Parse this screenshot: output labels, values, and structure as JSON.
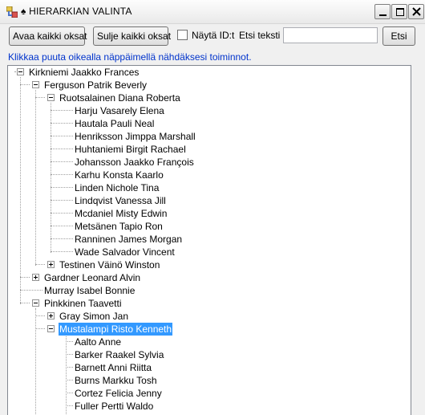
{
  "window": {
    "title": "HIERARKIAN VALINTA",
    "title_icon": "spade-icon"
  },
  "toolbar": {
    "expand_all_label": "Avaa kaikki oksat",
    "collapse_all_label": "Sulje kaikki oksat",
    "show_id_label": "Näytä ID:t",
    "show_id_checked": false,
    "search_label": "Etsi teksti",
    "search_value": "",
    "search_button_label": "Etsi"
  },
  "hint": "Klikkaa puuta oikealla näppäimellä nähdäksesi toiminnot.",
  "tree": {
    "root": "Kirkniemi Jaakko Frances",
    "nodes": [
      "Ferguson Patrik Beverly",
      "Ruotsalainen Diana Roberta",
      "Harju Vasarely Elena",
      "Hautala Pauli Neal",
      "Henriksson Jimppa Marshall",
      "Huhtaniemi Birgit Rachael",
      "Johansson Jaakko François",
      "Karhu Konsta Kaarlo",
      "Linden Nichole Tina",
      "Lindqvist Vanessa Jill",
      "Mcdaniel Misty Edwin",
      "Metsänen Tapio Ron",
      "Ranninen James Morgan",
      "Wade Salvador Vincent",
      "Testinen Väinö Winston",
      "Gardner Leonard Alvin",
      "Murray Isabel Bonnie",
      "Pinkkinen Taavetti",
      "Gray Simon Jan",
      "Mustalampi Risto Kenneth",
      "Aalto Anne",
      "Barker Raakel Sylvia",
      "Barnett Anni Riitta",
      "Burns Markku Tosh",
      "Cortez Felicia Jenny",
      "Fuller Pertti Waldo"
    ],
    "selected": "Mustalampi Risto Kenneth"
  }
}
